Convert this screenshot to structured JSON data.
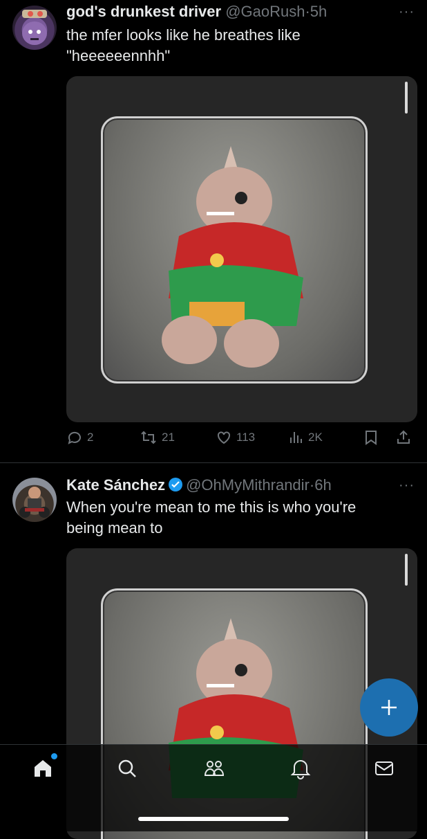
{
  "tweets": [
    {
      "name": "god's drunkest driver",
      "handle": "@GaoRush",
      "time": "5h",
      "text_line1": "the mfer looks like he breathes like",
      "text_line2": "\"heeeeeennhh\"",
      "verified": false,
      "stats": {
        "replies": "2",
        "reposts": "21",
        "likes": "113",
        "views": "2K"
      }
    },
    {
      "name": "Kate Sánchez",
      "handle": "@OhMyMithrandir",
      "time": "6h",
      "text_line1": "When you're mean to me this is who you're",
      "text_line2": "being mean to",
      "verified": true
    }
  ],
  "separator": "·",
  "more_glyph": "···",
  "colors": {
    "accent": "#1d9bf0",
    "fab": "#1d6fb0",
    "muted": "#71767b",
    "background": "#000000"
  },
  "nav": {
    "items": [
      "home-icon",
      "search-icon",
      "communities-icon",
      "notifications-icon",
      "messages-icon"
    ],
    "home_has_new": true
  },
  "fab_label": "+"
}
